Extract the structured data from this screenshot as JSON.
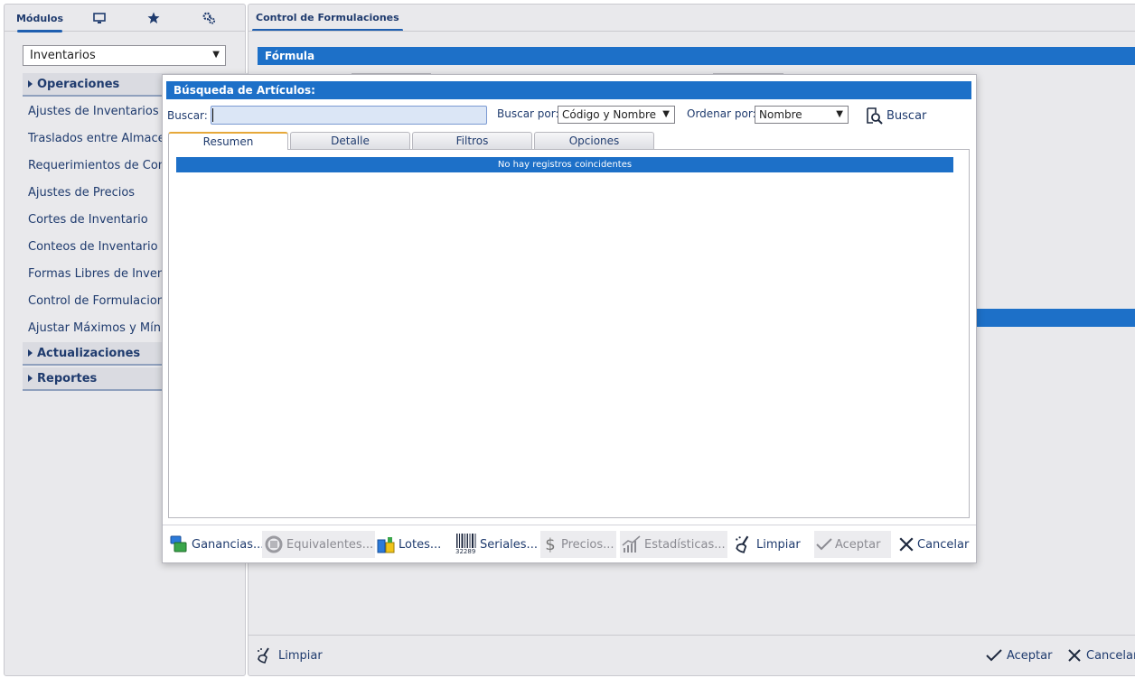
{
  "sidebar": {
    "tabs": {
      "modulos": "Módulos"
    },
    "module_select": "Inventarios",
    "groups": [
      {
        "label": "Operaciones"
      },
      {
        "label": "Actualizaciones"
      },
      {
        "label": "Reportes"
      }
    ],
    "items": [
      {
        "label": "Ajustes de Inventarios"
      },
      {
        "label": "Traslados entre Almacenes"
      },
      {
        "label": "Requerimientos de Compra"
      },
      {
        "label": "Ajustes de Precios"
      },
      {
        "label": "Cortes de Inventario"
      },
      {
        "label": "Conteos de Inventario"
      },
      {
        "label": "Formas Libres de Inventario"
      },
      {
        "label": "Control de Formulaciones"
      },
      {
        "label": "Ajustar Máximos y Mínimos"
      }
    ]
  },
  "main": {
    "tab": "Control de Formulaciones",
    "section": "Fórmula",
    "footer": {
      "limpiar": "Limpiar",
      "aceptar": "Aceptar",
      "cancelar": "Cancelar"
    }
  },
  "dialog": {
    "title": "Búsqueda de Artículos:",
    "buscar_label": "Buscar:",
    "buscar_value": "",
    "buscar_por_label": "Buscar por:",
    "buscar_por_value": "Código y Nombre",
    "ordenar_por_label": "Ordenar por:",
    "ordenar_por_value": "Nombre",
    "buscar_button": "Buscar",
    "tabs": [
      "Resumen",
      "Detalle",
      "Filtros",
      "Opciones"
    ],
    "empty_message": "No hay registros coincidentes",
    "actions": {
      "ganancias": "Ganancias...",
      "equivalentes": "Equivalentes...",
      "lotes": "Lotes...",
      "seriales": "Seriales...",
      "barcode_number": "32289",
      "precios": "Precios...",
      "estadisticas": "Estadísticas...",
      "limpiar": "Limpiar",
      "aceptar": "Aceptar",
      "cancelar": "Cancelar"
    }
  },
  "colors": {
    "accent_blue": "#1d70c8",
    "text_navy": "#1f3b6e",
    "active_tab_top": "#e6a83a",
    "panel_bg": "#e9e9ec"
  }
}
